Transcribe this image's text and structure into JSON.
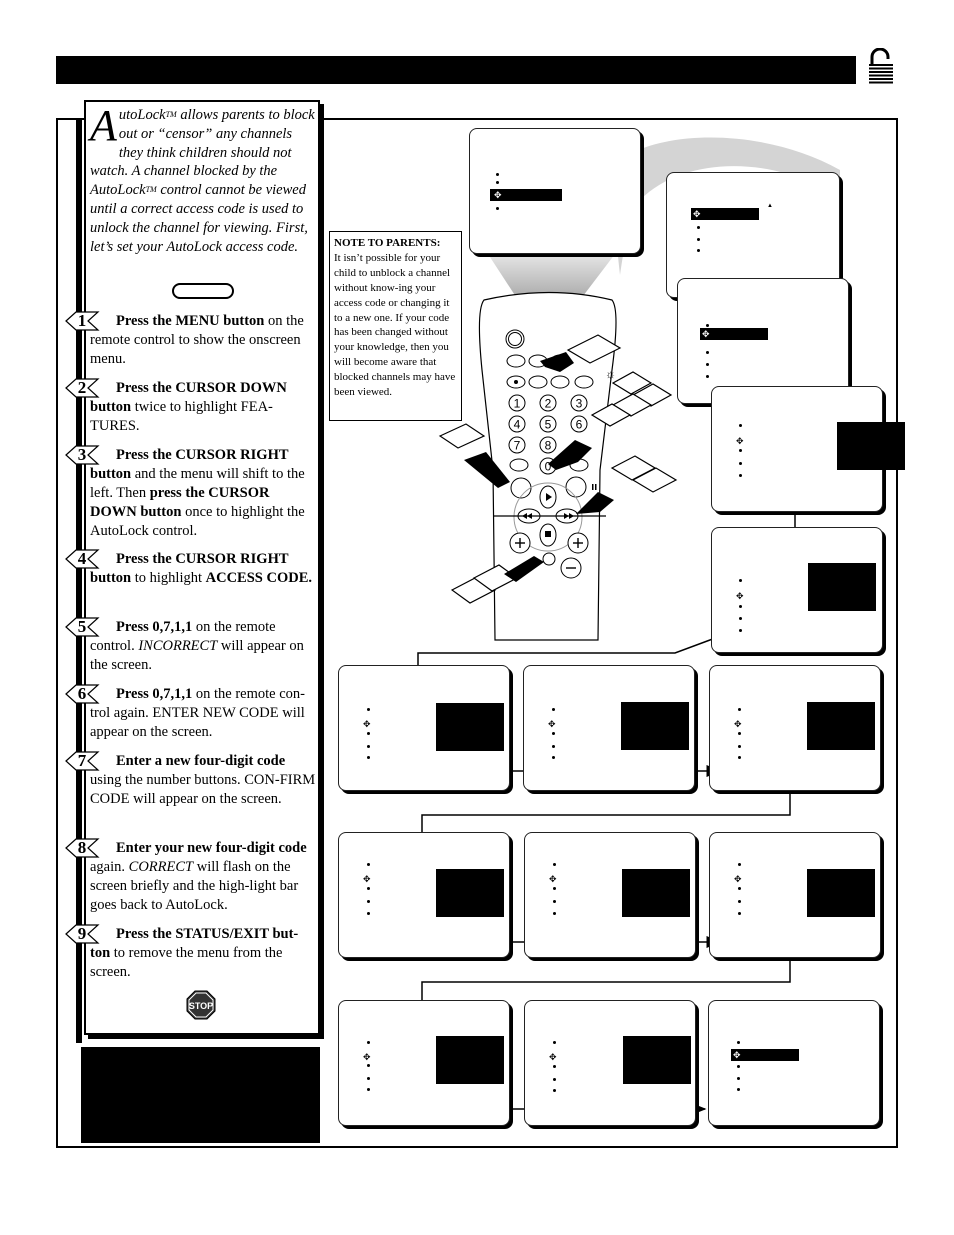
{
  "header": {
    "title": "",
    "lock_icon": "unlocked-padlock-icon"
  },
  "intro": {
    "drop_cap": "A",
    "first_word": "utoLock",
    "tm": "TM",
    "text_1": " allows parents to block out or “censor” any channels they think children should not watch.  A channel blocked by the AutoLock",
    "text_2": " control cannot be viewed until a correct access code is used to unlock the channel for viewing.  First, let’s set your AutoLock access code."
  },
  "steps": [
    {
      "num": "1",
      "bold": "Press the MENU button",
      "rest": " on the remote control to show the onscreen menu."
    },
    {
      "num": "2",
      "bold": "Press the CURSOR DOWN button",
      "rest": " twice to highlight FEA-TURES."
    },
    {
      "num": "3",
      "bold": "Press the CURSOR RIGHT button",
      "rest": " and the menu will shift to the left. Then ",
      "bold2": "press the CURSOR DOWN button",
      "rest2": " once to highlight the AutoLock control."
    },
    {
      "num": "4",
      "bold": "Press the CURSOR RIGHT button",
      "rest": " to highlight ",
      "bold2": "ACCESS CODE.",
      "rest2": ""
    },
    {
      "num": "5",
      "bold": "Press 0,7,1,1",
      "rest": " on the remote control.  ",
      "italic": "INCORRECT",
      "rest2": " will appear on the screen."
    },
    {
      "num": "6",
      "bold": "Press 0,7,1,1",
      "rest": " on the remote con-trol again. ENTER NEW CODE will appear on the screen."
    },
    {
      "num": "7",
      "bold": "Enter a new four-digit code",
      "rest": " using the number buttons.  CON-FIRM CODE will appear on the screen."
    },
    {
      "num": "8",
      "bold": "Enter your new four-digit code",
      "rest": " again. ",
      "italic": "CORRECT",
      "rest2": " will flash on the screen briefly and the high-light bar goes back to AutoLock."
    },
    {
      "num": "9",
      "bold": "Press the STATUS/EXIT but-ton",
      "rest": " to remove the menu from the screen."
    }
  ],
  "stop_sign": {
    "label": "STOP",
    "color": "#333333"
  },
  "note": {
    "heading": "NOTE TO PARENTS:",
    "body": "It isn’t possible for your child to unblock a channel without know-ing your access code or changing it to a new one.  If your code has been changed without your knowledge,  then you will become aware that blocked channels may have been viewed."
  },
  "remote": {
    "number_buttons": [
      "1",
      "2",
      "3",
      "4",
      "5",
      "6",
      "7",
      "8",
      "0"
    ],
    "transport_icons": [
      "play-icon",
      "rewind-icon",
      "fast-forward-icon",
      "stop-icon",
      "pause-icon"
    ],
    "volume_icons": [
      "plus-icon",
      "plus-icon",
      "minus-icon"
    ]
  },
  "screens": {
    "count": 14,
    "description": "onscreen menu progression screens (blank menus with bullet markers, highlight bars and black code panels)"
  }
}
